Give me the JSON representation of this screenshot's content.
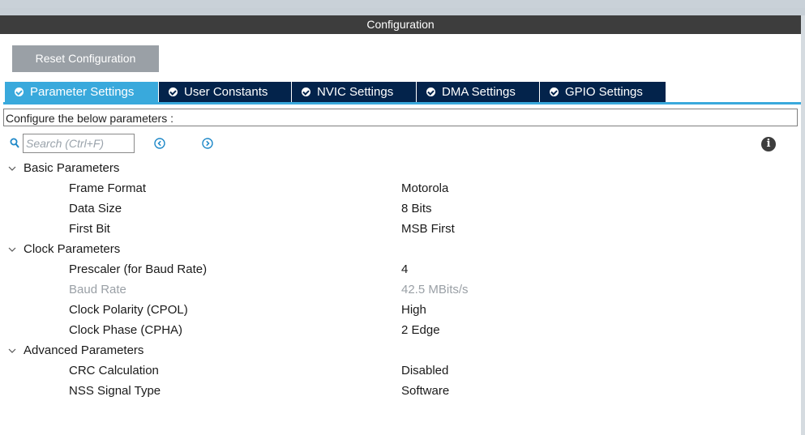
{
  "window": {
    "title": "Configuration"
  },
  "toolbar": {
    "reset_label": "Reset Configuration"
  },
  "tabs": [
    {
      "label": "Parameter Settings",
      "active": true
    },
    {
      "label": "User Constants",
      "active": false
    },
    {
      "label": "NVIC Settings",
      "active": false
    },
    {
      "label": "DMA Settings",
      "active": false
    },
    {
      "label": "GPIO Settings",
      "active": false
    }
  ],
  "description": "Configure the below parameters :",
  "search": {
    "placeholder": "Search (Ctrl+F)"
  },
  "groups": [
    {
      "name": "Basic Parameters",
      "params": [
        {
          "name": "Frame Format",
          "value": "Motorola",
          "disabled": false
        },
        {
          "name": "Data Size",
          "value": "8 Bits",
          "disabled": false
        },
        {
          "name": "First Bit",
          "value": "MSB First",
          "disabled": false
        }
      ]
    },
    {
      "name": "Clock Parameters",
      "params": [
        {
          "name": "Prescaler (for Baud Rate)",
          "value": "4",
          "disabled": false
        },
        {
          "name": "Baud Rate",
          "value": "42.5 MBits/s",
          "disabled": true
        },
        {
          "name": "Clock Polarity (CPOL)",
          "value": "High",
          "disabled": false
        },
        {
          "name": "Clock Phase (CPHA)",
          "value": "2 Edge",
          "disabled": false
        }
      ]
    },
    {
      "name": "Advanced Parameters",
      "params": [
        {
          "name": "CRC Calculation",
          "value": "Disabled",
          "disabled": false
        },
        {
          "name": "NSS Signal Type",
          "value": "Software",
          "disabled": false
        }
      ]
    }
  ],
  "colors": {
    "active_tab": "#39a9dc",
    "tab": "#03234b",
    "titlebar": "#3d3d3d",
    "disabled_text": "#9aa0a6"
  },
  "icons": {
    "search": "search-icon",
    "prev": "circle-chevron-left-icon",
    "next": "circle-chevron-right-icon",
    "info": "info-icon",
    "expand": "chevron-down-icon",
    "tab_check": "check-circle-icon"
  }
}
